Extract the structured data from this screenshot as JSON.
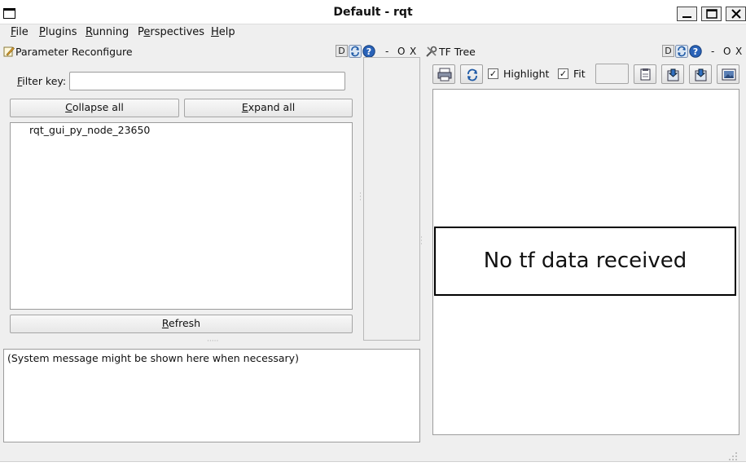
{
  "window": {
    "title": "Default - rqt"
  },
  "menu": [
    {
      "label": "File",
      "mnemonic": "F",
      "rest": "ile"
    },
    {
      "label": "Plugins",
      "mnemonic": "P",
      "rest": "lugins"
    },
    {
      "label": "Running",
      "mnemonic": "R",
      "rest": "unning"
    },
    {
      "label": "Perspectives",
      "pre": "P",
      "mnemonic": "e",
      "rest": "rspectives"
    },
    {
      "label": "Help",
      "mnemonic": "H",
      "rest": "elp"
    }
  ],
  "param_dock": {
    "title": "Parameter Reconfigure",
    "dock_d": "D",
    "dock_min": "-",
    "dock_float": "O",
    "dock_close": "X",
    "filter_label_mn": "F",
    "filter_label_rest": "ilter key:",
    "filter_value": "",
    "collapse_mn": "C",
    "collapse_rest": "ollapse all",
    "expand_mn": "E",
    "expand_rest": "xpand all",
    "nodes": [
      "rqt_gui_py_node_23650"
    ],
    "refresh_mn": "R",
    "refresh_rest": "efresh",
    "system_message": "(System message might be shown here when necessary)"
  },
  "tf_dock": {
    "title": "TF Tree",
    "dock_d": "D",
    "dock_min": "-",
    "dock_float": "O",
    "dock_close": "X",
    "highlight_label": "Highlight",
    "highlight_checked": true,
    "fit_label": "Fit",
    "fit_checked": true,
    "check_mark": "✓",
    "empty_message": "No tf data received"
  },
  "icons": {
    "window": "window-icon",
    "param": "edit-icon",
    "tf": "tools-icon",
    "refresh": "refresh-icon",
    "help": "help-icon"
  }
}
